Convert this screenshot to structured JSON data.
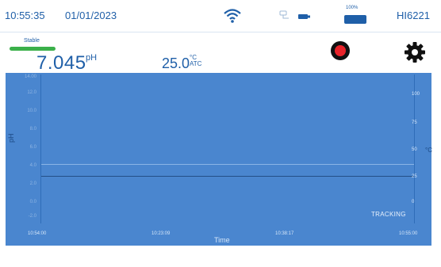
{
  "statusbar": {
    "time": "10:55:35",
    "date": "01/01/2023",
    "model": "HI6221",
    "battery_label": "100%",
    "icons": [
      "wifi-icon",
      "usb-icon",
      "battery-icon"
    ]
  },
  "reading": {
    "stability_label": "Stable",
    "ph_value": "7.045",
    "ph_unit": "pH",
    "temp_value": "25.0",
    "temp_unit_top": "°C",
    "temp_unit_bottom": "ATC"
  },
  "graph": {
    "y_label": "pH",
    "right_axis_symbol": "°C",
    "x_label": "Time",
    "mode_label": "TRACKING",
    "left_ticks": [
      "14.00",
      "12.0",
      "10.0",
      "8.0",
      "6.0",
      "4.0",
      "2.0",
      "0.0",
      "-2.0"
    ],
    "right_ticks": [
      "100",
      "75",
      "50",
      "25",
      "0"
    ],
    "x_ticks": [
      "10:54:00",
      "10:23:09",
      "10:38:17",
      "10:55:00"
    ]
  },
  "colors": {
    "accent": "#1f5fa8",
    "graph_bg": "#4a86cf",
    "stable": "#3bb04a",
    "record": "#e8232a"
  }
}
